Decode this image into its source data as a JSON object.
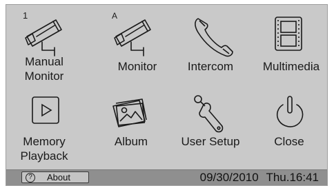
{
  "menu": {
    "manual_monitor": "Manual\nMonitor",
    "monitor": "Monitor",
    "intercom": "Intercom",
    "multimedia": "Multimedia",
    "memory_playback": "Memory\nPlayback",
    "album": "Album",
    "user_setup": "User Setup",
    "close": "Close"
  },
  "icons": {
    "manual_monitor": "security-camera-icon",
    "manual_monitor_badge": "1",
    "monitor": "security-camera-auto-icon",
    "monitor_badge": "A",
    "intercom": "phone-handset-icon",
    "multimedia": "film-icon",
    "memory_playback": "play-icon",
    "album": "photos-icon",
    "user_setup": "wrench-icon",
    "close": "power-icon"
  },
  "status_bar": {
    "about_label": "About",
    "about_icon": "?",
    "date": "09/30/2010",
    "time": "Thu.16:41"
  },
  "colors": {
    "panel": "#c9c9c9",
    "status_bar": "#8f8f8f"
  }
}
